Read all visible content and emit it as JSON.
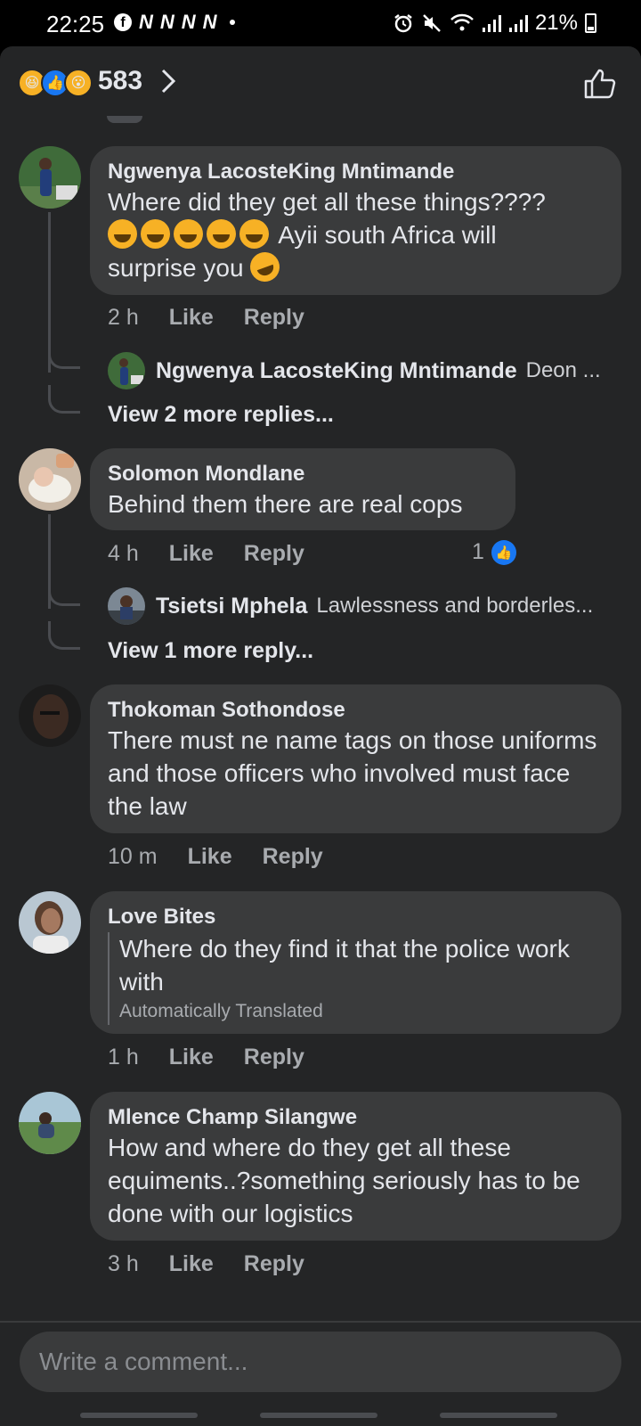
{
  "status_bar": {
    "time": "22:25",
    "notif_letters": [
      "N",
      "N",
      "N",
      "N"
    ],
    "battery": "21%"
  },
  "reactions": {
    "types": [
      "haha",
      "like",
      "wow"
    ],
    "count": "583"
  },
  "comments": [
    {
      "name": "Ngwenya LacosteKing  Mntimande",
      "text_lines": [
        "Where did they get all these things????",
        " Ayii south Africa will",
        "surprise you "
      ],
      "time": "2 h",
      "like": "Like",
      "reply": "Reply",
      "reply_preview": {
        "name": "Ngwenya LacosteKing  Mntimande",
        "text": "Deon ..."
      },
      "view_more": "View 2 more replies..."
    },
    {
      "name": "Solomon Mondlane",
      "text": "Behind them there are real cops",
      "time": "4 h",
      "like": "Like",
      "reply": "Reply",
      "like_count": "1",
      "reply_preview": {
        "name": "Tsietsi Mphela",
        "text": "Lawlessness and borderles..."
      },
      "view_more": "View 1 more reply..."
    },
    {
      "name": "Thokoman Sothondose",
      "text": "There must ne name tags on those uniforms and those officers who involved must face the law",
      "time": "10 m",
      "like": "Like",
      "reply": "Reply"
    },
    {
      "name": "Love Bites",
      "text": "Where do they find it that the police work with",
      "translated_note": "Automatically Translated",
      "time": "1 h",
      "like": "Like",
      "reply": "Reply"
    },
    {
      "name": "Mlence Champ Silangwe",
      "text": "How and where do they get all these equiments..?something seriously has to be done with our logistics",
      "time": "3 h",
      "like": "Like",
      "reply": "Reply"
    }
  ],
  "composer": {
    "placeholder": "Write a comment..."
  }
}
